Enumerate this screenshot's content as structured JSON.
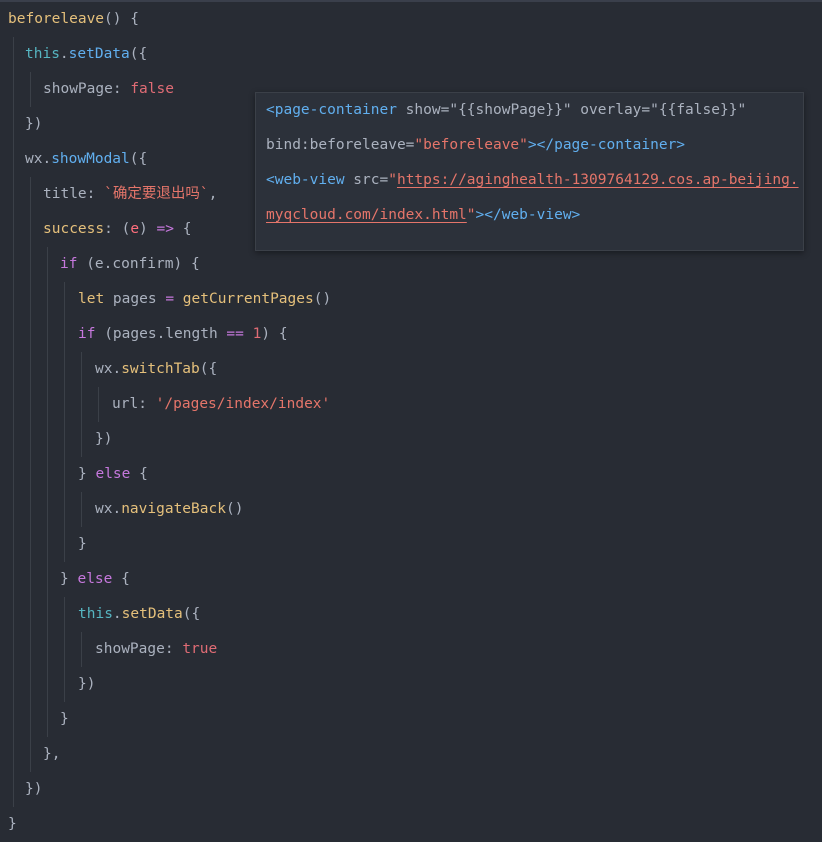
{
  "code": {
    "l1": {
      "name": "beforeleave",
      "rest": "() {"
    },
    "l2": {
      "this": "this",
      "dot": ".",
      "fn": "setData",
      "rest": "({"
    },
    "l3": {
      "key": "showPage",
      "colon": ": ",
      "val": "false"
    },
    "l4": {
      "text": "})"
    },
    "l5": {
      "obj": "wx",
      "dot": ".",
      "fn": "showModal",
      "rest": "({"
    },
    "l6": {
      "key": "title",
      "colon": ": ",
      "val": "`确定要退出吗`",
      "comma": ","
    },
    "l7": {
      "key": "success",
      "colon": ": ",
      "p1": "(",
      "param": "e",
      "p2": ")",
      "arrow": " => ",
      "brace": "{"
    },
    "l8": {
      "kw": "if",
      "rest": " (e.confirm) {"
    },
    "l9": {
      "kw": "let",
      "var": " pages ",
      "eq": "=",
      "fn": " getCurrentPages",
      "rest": "()"
    },
    "l10": {
      "kw": "if",
      "rest1": " (pages.length ",
      "eq": "==",
      "num": " 1",
      "rest2": ") {"
    },
    "l11": {
      "obj": "wx",
      "dot": ".",
      "fn": "switchTab",
      "rest": "({"
    },
    "l12": {
      "key": "url",
      "colon": ": ",
      "val": "'/pages/index/index'"
    },
    "l13": {
      "text": "})"
    },
    "l14": {
      "b": "} ",
      "kw": "else",
      "rest": " {"
    },
    "l15": {
      "obj": "wx",
      "dot": ".",
      "fn": "navigateBack",
      "rest": "()"
    },
    "l16": {
      "text": "}"
    },
    "l17": {
      "b": "} ",
      "kw": "else",
      "rest": " {"
    },
    "l18": {
      "this": "this",
      "dot": ".",
      "fn": "setData",
      "rest": "({"
    },
    "l19": {
      "key": "showPage",
      "colon": ": ",
      "val": "true"
    },
    "l20": {
      "text": "})"
    },
    "l21": {
      "text": "}"
    },
    "l22": {
      "text": "},"
    },
    "l23": {
      "text": "})"
    },
    "l24": {
      "text": "}"
    }
  },
  "hover": {
    "h1": {
      "open": "<page-container",
      "a1": " show=",
      "v1": "\"{{showPage}}\"",
      "a2": " overlay=",
      "v2": "\"{{false}}\""
    },
    "h2": {
      "a": "bind:beforeleave=",
      "v": "\"beforeleave\"",
      "close": "></page-container>"
    },
    "h3": {
      "open": "<web-view",
      "a": " src=",
      "q": "\"",
      "url": "https://aginghealth-1309764129.cos.ap-beijing."
    },
    "h4": {
      "url": "myqcloud.com/index.html",
      "q": "\"",
      "close": "></web-view>"
    }
  },
  "colors": {
    "background": "#282c34",
    "keyword": "#c678dd",
    "function": "#61afef",
    "string": "#e5756a",
    "boolean": "#e06c75",
    "number": "#d19a66",
    "this": "#56b6c2",
    "tooltip_bg": "#2c313a"
  }
}
